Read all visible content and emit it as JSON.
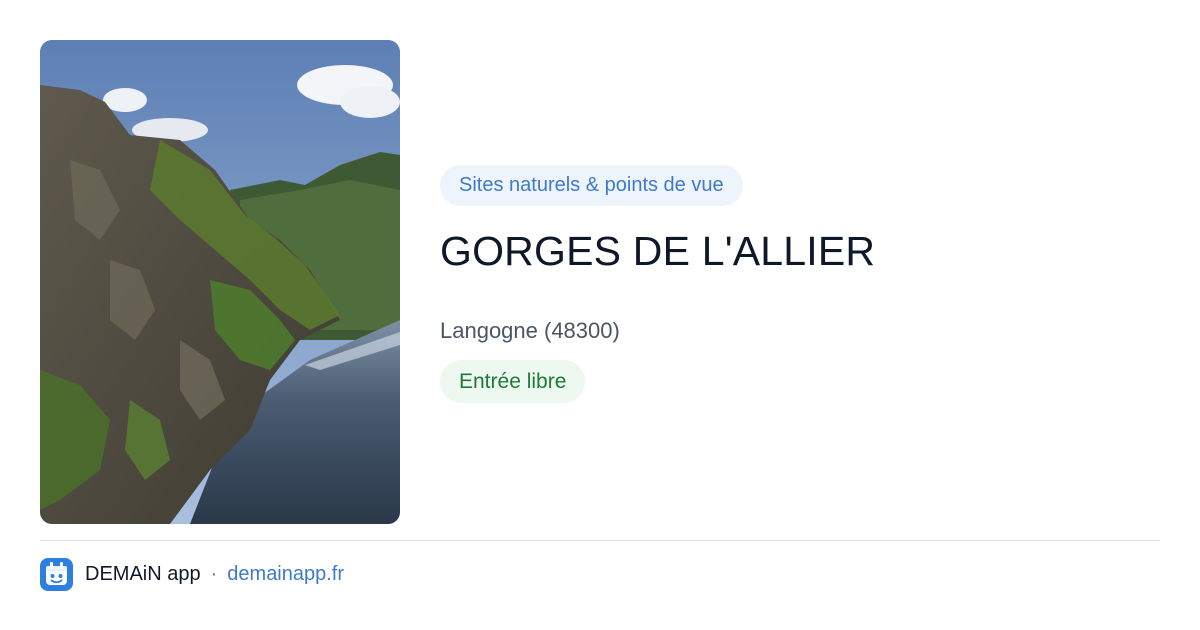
{
  "photo": {
    "alt": "Gorges de l'Allier"
  },
  "category": "Sites naturels & points de vue",
  "title": "GORGES DE L'ALLIER",
  "location": "Langogne (48300)",
  "access": "Entrée libre",
  "footer": {
    "app_name": "DEMAiN app",
    "separator": "·",
    "link": "demainapp.fr",
    "logo_icon": "demain-app-logo-icon"
  },
  "colors": {
    "category_text": "#3f7ac9",
    "category_bg": "#eef4fb",
    "access_text": "#1f7a3a",
    "access_bg": "#edf8f0",
    "title": "#0f172a",
    "location": "#4b5563",
    "link": "#3f7ac9"
  }
}
